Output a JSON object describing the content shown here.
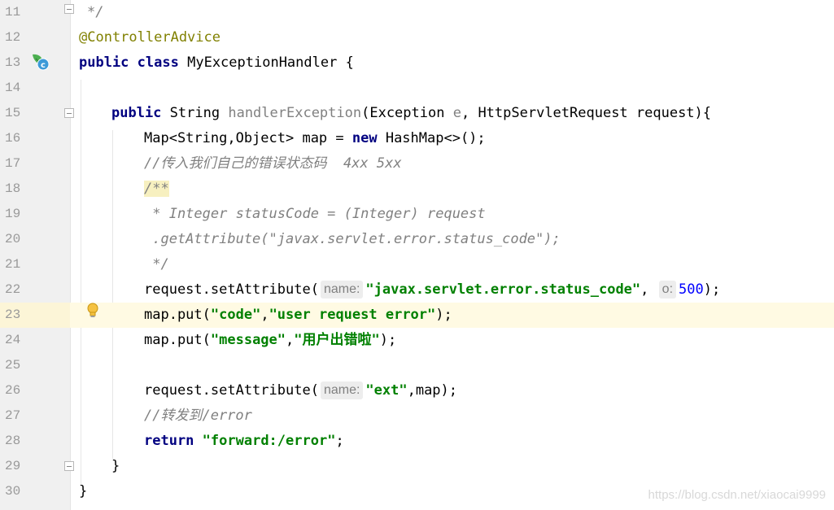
{
  "editor": {
    "line_numbers": [
      "11",
      "12",
      "13",
      "14",
      "15",
      "16",
      "17",
      "18",
      "19",
      "20",
      "21",
      "22",
      "23",
      "24",
      "25",
      "26",
      "27",
      "28",
      "29",
      "30"
    ],
    "current_line": "23",
    "code": {
      "l11": {
        "comment": "*/"
      },
      "l12": {
        "annotation": "@ControllerAdvice"
      },
      "l13": {
        "kw_public": "public",
        "kw_class": "class",
        "class_name": "MyExceptionHandler",
        "brace": "{"
      },
      "l15": {
        "kw_public": "public",
        "return_type": "String",
        "method_name": "handlerException",
        "params_open": "(Exception",
        "param_e": "e",
        "params_rest": ", HttpServletRequest request){"
      },
      "l16": {
        "prefix": "Map<String,Object> map = ",
        "kw_new": "new",
        "suffix": " HashMap<>();"
      },
      "l17": {
        "comment": "//传入我们自己的错误状态码  4xx 5xx"
      },
      "l18": {
        "comment": "/**"
      },
      "l19": {
        "comment": " * Integer statusCode = (Integer) request"
      },
      "l20": {
        "comment": " .getAttribute(\"javax.servlet.error.status_code\");"
      },
      "l21": {
        "comment": " */"
      },
      "l22": {
        "prefix": "request.setAttribute(",
        "hint_name": "name:",
        "str": "\"javax.servlet.error.status_code\"",
        "sep": ",",
        "hint_o": "o:",
        "num": "500",
        "suffix": ");"
      },
      "l23": {
        "prefix": "map.put(",
        "str1": "\"code\"",
        "sep": ",",
        "str2": "\"user request error\"",
        "suffix": ");"
      },
      "l24": {
        "prefix": "map.put(",
        "str1": "\"message\"",
        "sep": ",",
        "str2": "\"用户出错啦\"",
        "suffix": ");"
      },
      "l26": {
        "prefix": "request.setAttribute(",
        "hint_name": "name:",
        "str": "\"ext\"",
        "suffix": ",map);"
      },
      "l27": {
        "comment": "//转发到/error"
      },
      "l28": {
        "kw_return": "return",
        "str": "\"forward:/error\"",
        "suffix": ";"
      },
      "l29": {
        "brace": "}"
      },
      "l30": {
        "brace": "}"
      }
    },
    "icons": {
      "class_icon": "class-icon",
      "intention_icon": "lightbulb-icon",
      "class_icon_letter": "c"
    },
    "colors": {
      "keyword": "#000080",
      "annotation": "#808000",
      "string": "#008000",
      "number": "#0000ff",
      "comment": "#808080",
      "current_line": "#fffae3"
    }
  },
  "watermark": "https://blog.csdn.net/xiaocai9999"
}
